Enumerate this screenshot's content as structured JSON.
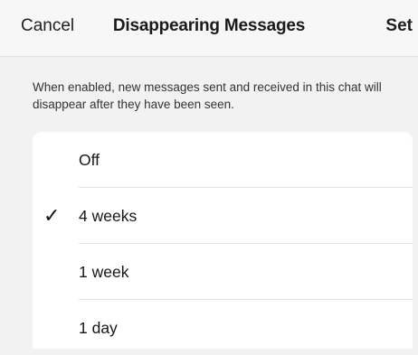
{
  "nav": {
    "cancel_label": "Cancel",
    "title": "Disappearing Messages",
    "set_label": "Set"
  },
  "description": "When enabled, new messages sent and received in this chat will disappear after they have been seen.",
  "options": [
    {
      "label": "Off",
      "selected": false
    },
    {
      "label": "4 weeks",
      "selected": true
    },
    {
      "label": "1 week",
      "selected": false
    },
    {
      "label": "1 day",
      "selected": false
    }
  ],
  "check_glyph": "✓",
  "icons": {
    "selected": "checkmark-icon"
  },
  "colors": {
    "background": "#f2f2f2",
    "list_background": "#ffffff",
    "text": "#1a1a1a"
  }
}
